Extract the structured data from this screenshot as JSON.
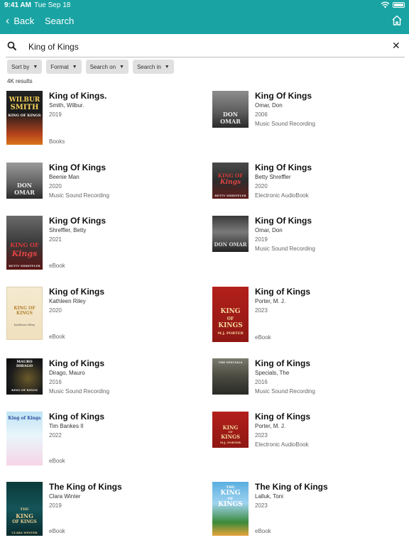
{
  "status": {
    "time": "9:41 AM",
    "date": "Tue Sep 18"
  },
  "nav": {
    "back_label": "Back",
    "title": "Search"
  },
  "search": {
    "query": "King of Kings"
  },
  "filters": [
    "Sort by",
    "Format",
    "Search on",
    "Search in"
  ],
  "result_count": "4K results",
  "results": [
    {
      "title": "King of Kings.",
      "author": "Smith, Wilbur.",
      "year": "2019",
      "format": "Books",
      "cover_lines": [
        "WILBUR",
        "SMITH",
        "KING OF KINGS"
      ]
    },
    {
      "title": "King Of Kings",
      "author": "Omar, Don",
      "year": "2006",
      "format": "Music Sound Recording",
      "cover_lines": [
        "DON OMAR"
      ]
    },
    {
      "title": "King Of Kings",
      "author": "Beenie Man",
      "year": "2020",
      "format": "Music Sound Recording",
      "cover_lines": [
        "DON OMAR"
      ]
    },
    {
      "title": "King Of Kings",
      "author": "Betty Shreffler",
      "year": "2020",
      "format": "Electronic AudioBook",
      "cover_lines": [
        "KING OF",
        "Kings",
        "BETTY SHREFFLER"
      ]
    },
    {
      "title": "King Of Kings",
      "author": "Shreffler, Betty",
      "year": "2021",
      "format": "eBook",
      "cover_lines": [
        "KING OF",
        "Kings",
        "BETTY SHREFFLER"
      ]
    },
    {
      "title": "King Of Kings",
      "author": "Omar, Don",
      "year": "2019",
      "format": "Music Sound Recording",
      "cover_lines": [
        "DON OMAR"
      ]
    },
    {
      "title": "King of Kings",
      "author": "Kathleen Riley",
      "year": "2020",
      "format": "eBook",
      "cover_lines": [
        "KING OF KINGS",
        "Kathleen Riley"
      ]
    },
    {
      "title": "King of Kings",
      "author": "Porter, M. J.",
      "year": "2023",
      "format": "eBook",
      "cover_lines": [
        "KING",
        "OF",
        "KINGS",
        "M.J. PORTER"
      ]
    },
    {
      "title": "King of Kings",
      "author": "Dirago, Mauro",
      "year": "2016",
      "format": "Music Sound Recording",
      "cover_lines": [
        "MAURO",
        "DIRAGO",
        "KING OF KINGS"
      ]
    },
    {
      "title": "King of Kings",
      "author": "Specials, The",
      "year": "2016",
      "format": "Music Sound Recording",
      "cover_lines": [
        "THE SPECIALS"
      ]
    },
    {
      "title": "King of Kings",
      "author": "Tim Bankes II",
      "year": "2022",
      "format": "eBook",
      "cover_lines": [
        "King of Kings"
      ]
    },
    {
      "title": "King of Kings",
      "author": "Porter, M. J.",
      "year": "2023",
      "format": "Electronic AudioBook",
      "cover_lines": [
        "KING",
        "OF",
        "KINGS",
        "M.J. PORTER"
      ]
    },
    {
      "title": "The King of Kings",
      "author": "Clara Winter",
      "year": "2019",
      "format": "eBook",
      "cover_lines": [
        "THE",
        "KING",
        "OF KINGS",
        "CLARA WINTER"
      ]
    },
    {
      "title": "The King of Kings",
      "author": "Lalluk, Toni",
      "year": "2023",
      "format": "eBook",
      "cover_lines": [
        "THE",
        "KING",
        "OF",
        "KINGS"
      ]
    }
  ],
  "colors": {
    "accent": "#19a3a3"
  }
}
